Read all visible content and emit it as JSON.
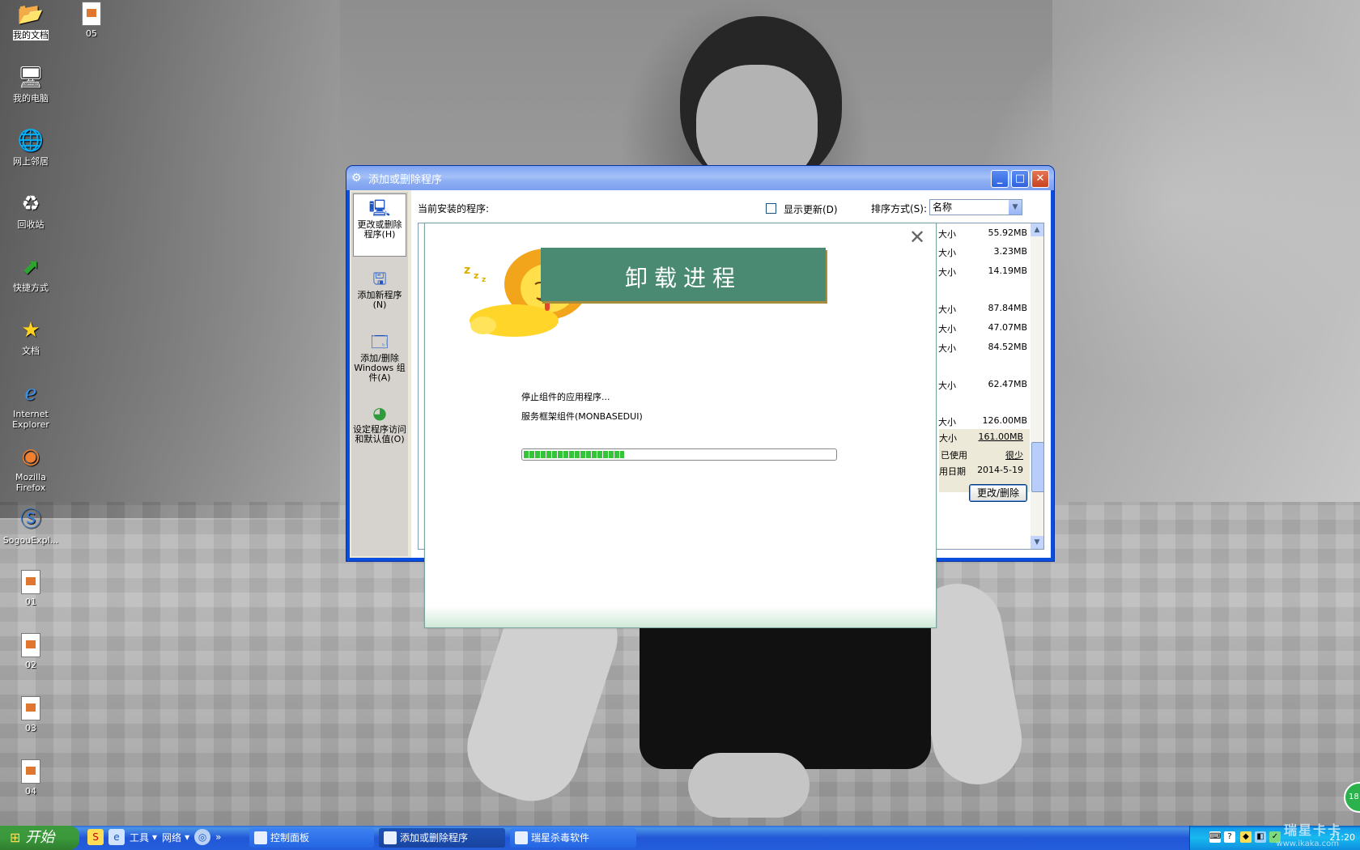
{
  "desktop": {
    "icons": [
      {
        "label": "我的文档",
        "icon": "my-documents-icon"
      },
      {
        "label": "05",
        "icon": "document-file-icon"
      },
      {
        "label": "我的电脑",
        "icon": "my-computer-icon"
      },
      {
        "label": "网上邻居",
        "icon": "network-places-icon"
      },
      {
        "label": "回收站",
        "icon": "recycle-bin-icon"
      },
      {
        "label": "快捷方式",
        "icon": "shortcut-arrow-icon"
      },
      {
        "label": "文档",
        "icon": "star-icon"
      },
      {
        "label": "Internet Explorer",
        "icon": "internet-explorer-icon"
      },
      {
        "label": "Mozilla Firefox",
        "icon": "firefox-icon"
      },
      {
        "label": "SogouExpl...",
        "icon": "sogou-explorer-icon"
      },
      {
        "label": "01",
        "icon": "document-file-icon"
      },
      {
        "label": "02",
        "icon": "document-file-icon"
      },
      {
        "label": "03",
        "icon": "document-file-icon"
      },
      {
        "label": "04",
        "icon": "document-file-icon"
      }
    ]
  },
  "window": {
    "title": "添加或删除程序",
    "sidebar": [
      {
        "label": "更改或删除程序(H)",
        "icon": "change-remove-programs-icon",
        "active": true
      },
      {
        "label": "添加新程序(N)",
        "icon": "add-new-programs-icon",
        "active": false
      },
      {
        "label": "添加/删除 Windows 组件(A)",
        "icon": "windows-components-icon",
        "active": false
      },
      {
        "label": "设定程序访问和默认值(O)",
        "icon": "program-access-defaults-icon",
        "active": false
      }
    ],
    "installed_label": "当前安装的程序:",
    "show_updates_label": "显示更新(D)",
    "sort_label": "排序方式(S):",
    "sort_value": "名称",
    "rows": [
      {
        "key": "大小",
        "value": "55.92MB"
      },
      {
        "key": "大小",
        "value": "3.23MB"
      },
      {
        "key": "大小",
        "value": "14.19MB"
      },
      {
        "key": "大小",
        "value": "87.84MB"
      },
      {
        "key": "大小",
        "value": "47.07MB"
      },
      {
        "key": "大小",
        "value": "84.52MB"
      },
      {
        "key": "大小",
        "value": "62.47MB"
      },
      {
        "key": "大小",
        "value": "126.00MB"
      },
      {
        "key": "大小",
        "value": "161.00MB"
      }
    ],
    "selected": {
      "used_label": "已使用",
      "used_value": "很少",
      "date_label": "用日期",
      "date_value": "2014-5-19",
      "change_button": "更改/删除"
    }
  },
  "dialog": {
    "title": "卸载进程",
    "status_line1": "停止组件的应用程序...",
    "status_line2": "服务框架组件(MONBASEDUI)",
    "progress": 0.33,
    "close_icon": "close-x-icon"
  },
  "taskbar": {
    "start_label": "开始",
    "quick": [
      {
        "label": "工具"
      },
      {
        "label": "网络"
      }
    ],
    "more": "»",
    "tasks": [
      {
        "label": "控制面板",
        "active": false
      },
      {
        "label": "添加或删除程序",
        "active": true
      },
      {
        "label": "瑞星杀毒软件",
        "active": false
      }
    ],
    "clock": "21:20",
    "watermark": "瑞星卡卡",
    "watermark_url": "www.ikaka.com",
    "float_badge": "18"
  }
}
